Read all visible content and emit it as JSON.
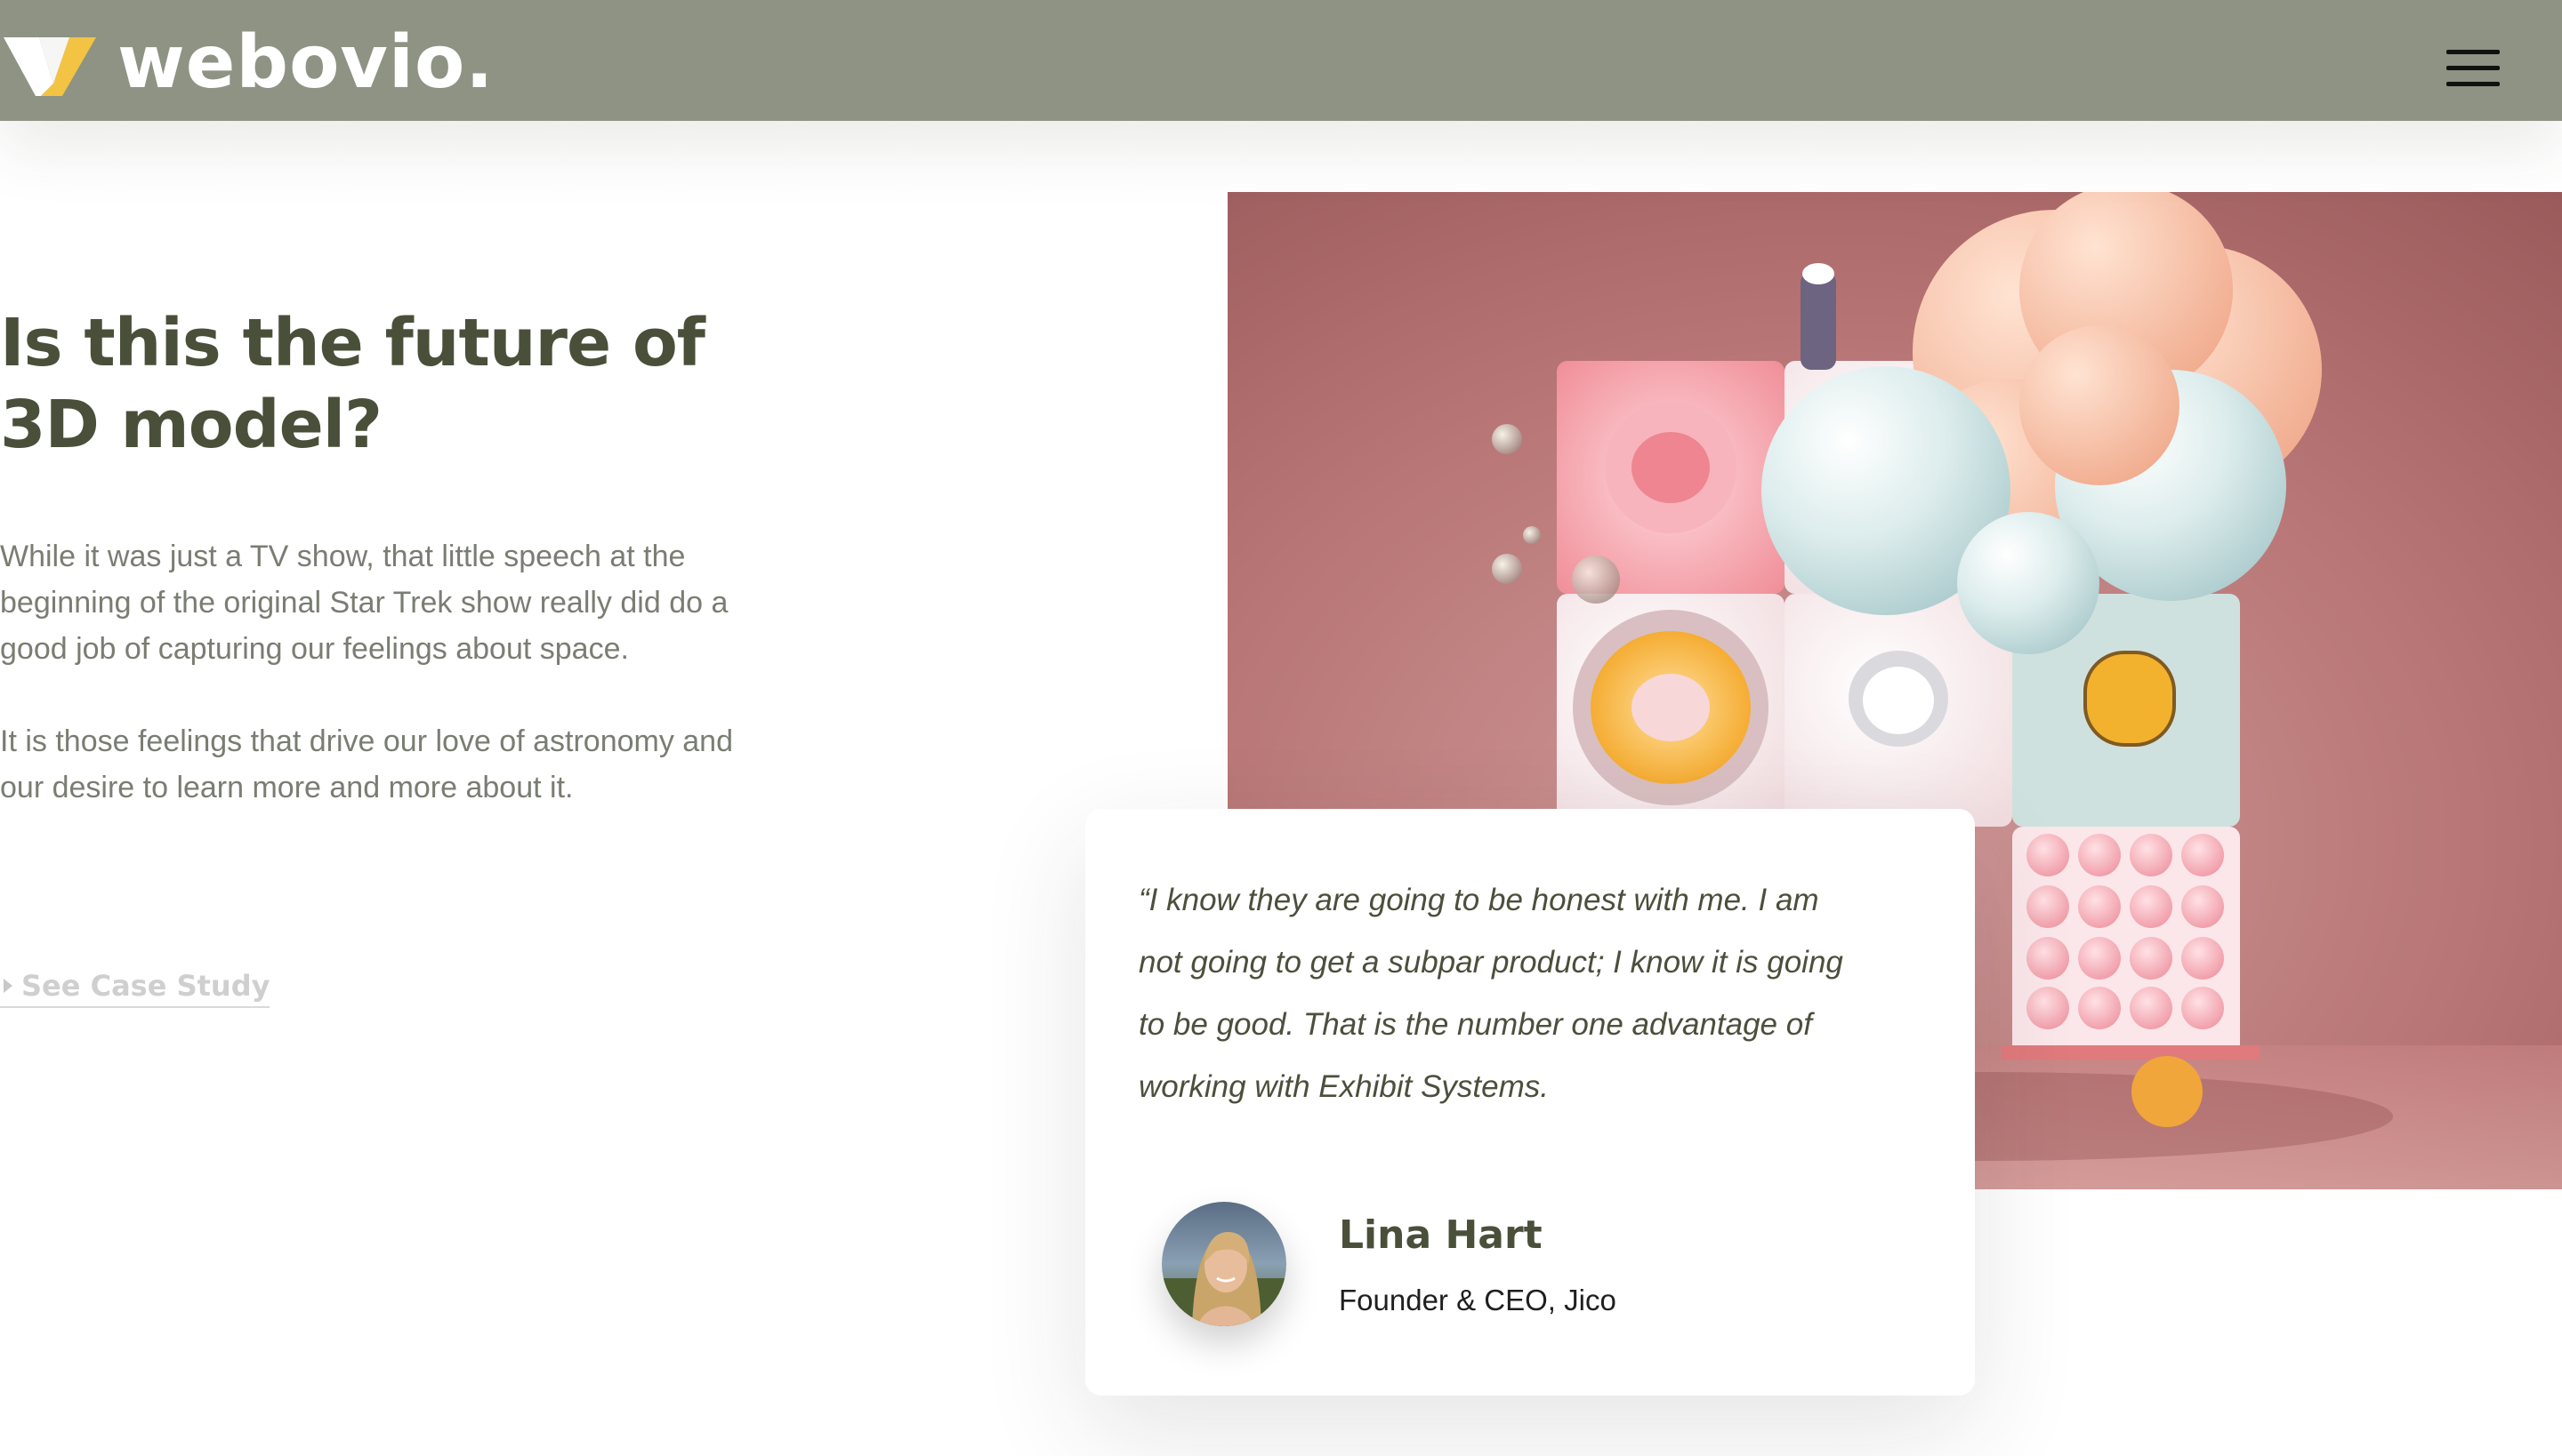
{
  "header": {
    "logo_text": "webovio.",
    "menu_icon": "hamburger-menu-icon",
    "background": "#8e9383"
  },
  "hero": {
    "title": "Is this the future of\n3D model?",
    "paragraphs": [
      "While it was just a TV show, that little speech at the beginning of the original Star Trek show really did do a good job of capturing our feelings about space.",
      "It is those feelings that drive our love of astronomy and our desire to learn more and more about it."
    ],
    "link_label": "See Case Study",
    "title_color": "#4a4f3a"
  },
  "testimonial": {
    "quote": "“I know they are going to be honest with me. I am not going to get a subpar product; I know it is going to be good. That is the number one advantage of working with Exhibit Systems.",
    "author_name": "Lina Hart",
    "author_role": "Founder & CEO, Jico"
  }
}
